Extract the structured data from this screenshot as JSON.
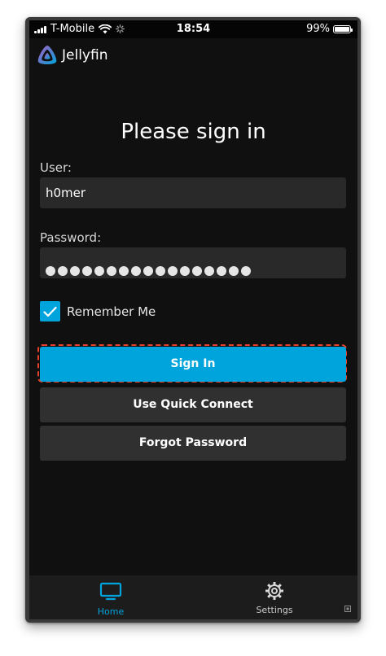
{
  "status_bar": {
    "carrier": "T-Mobile",
    "time": "18:54",
    "battery": "99%",
    "battery_level": 0.99
  },
  "header": {
    "app_name": "Jellyfin",
    "logo_icon": "jellyfin-logo",
    "logo_colors": [
      "#aa5cc3",
      "#00a4dc"
    ]
  },
  "login": {
    "title": "Please sign in",
    "user_label": "User:",
    "user_value": "h0mer",
    "password_label": "Password:",
    "password_mask": "●●●●●●●●●●●●●●●●●",
    "password_length": 17,
    "remember_label": "Remember Me",
    "remember_checked": true,
    "sign_in": "Sign In",
    "quick_connect": "Use Quick Connect",
    "forgot_password": "Forgot Password"
  },
  "tabs": [
    {
      "label": "Home",
      "icon": "tv-icon",
      "active": true
    },
    {
      "label": "Settings",
      "icon": "gear-icon",
      "active": false
    }
  ],
  "colors": {
    "accent": "#00a4dc",
    "background": "#101010",
    "input": "#292929",
    "button": "#303030",
    "focus_outline": "#e8412b",
    "inactive_tab": "#cccccc"
  }
}
